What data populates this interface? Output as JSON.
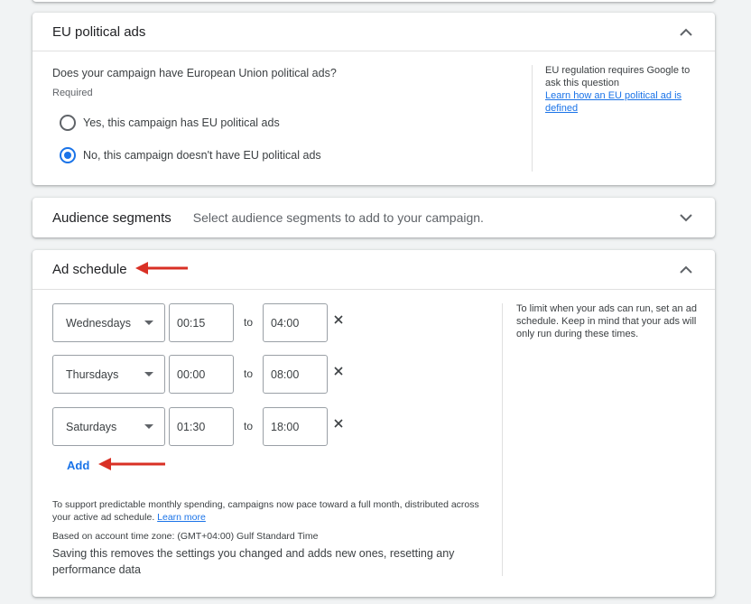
{
  "eu_political_ads": {
    "title": "EU political ads",
    "question": "Does your campaign have European Union political ads?",
    "required": "Required",
    "options": [
      {
        "label": "Yes, this campaign has EU political ads",
        "checked": false
      },
      {
        "label": "No, this campaign doesn't have EU political ads",
        "checked": true
      }
    ],
    "side_note": "EU regulation requires Google to ask this question",
    "side_link": "Learn how an EU political ad is defined"
  },
  "audience_segments": {
    "title": "Audience segments",
    "hint": "Select audience segments to add to your campaign."
  },
  "ad_schedule": {
    "title": "Ad schedule",
    "to_label": "to",
    "rows": [
      {
        "day": "Wednesdays",
        "from": "00:15",
        "to": "04:00"
      },
      {
        "day": "Thursdays",
        "from": "00:00",
        "to": "08:00"
      },
      {
        "day": "Saturdays",
        "from": "01:30",
        "to": "18:00"
      }
    ],
    "add_label": "Add",
    "pacing_note": "To support predictable monthly spending, campaigns now pace toward a full month, distributed across your active ad schedule.",
    "learn_more": "Learn more",
    "timezone_note": "Based on account time zone: (GMT+04:00) Gulf Standard Time",
    "saving_note": "Saving this removes the settings you changed and adds new ones, resetting any performance data",
    "side_note": "To limit when your ads can run, set an ad schedule. Keep in mind that your ads will only run during these times."
  },
  "colors": {
    "accent": "#1a73e8",
    "annotation_arrow": "#d93025",
    "background": "#f1f3f4"
  },
  "icons": [
    "chevron-up-icon",
    "chevron-down-icon",
    "dropdown-arrow-icon",
    "close-icon",
    "annotation-arrow-icon"
  ]
}
